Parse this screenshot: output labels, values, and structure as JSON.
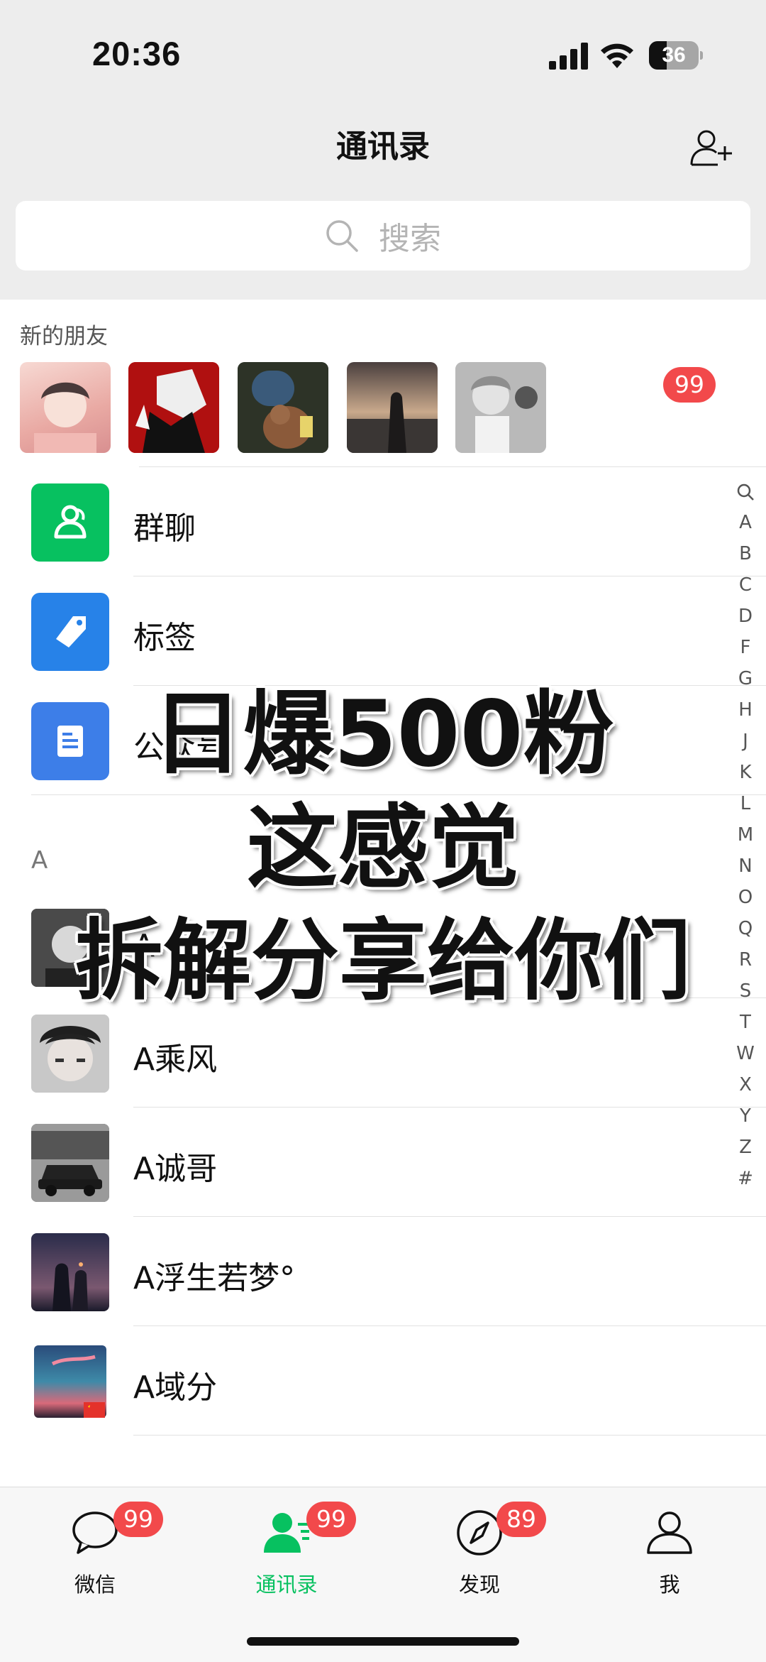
{
  "status_bar": {
    "time": "20:36",
    "battery": "36",
    "battery_level": 0.36
  },
  "header": {
    "title": "通讯录"
  },
  "search": {
    "placeholder": "搜索"
  },
  "new_friends": {
    "label": "新的朋友",
    "badge": "99"
  },
  "functions": [
    {
      "label": "群聊",
      "color": "#07c160"
    },
    {
      "label": "标签",
      "color": "#2782e8"
    },
    {
      "label": "公众号",
      "color": "#3d7ee8"
    }
  ],
  "section": {
    "letter": "A"
  },
  "contacts": [
    {
      "name": "A"
    },
    {
      "name": "A乘风"
    },
    {
      "name": "A诚哥"
    },
    {
      "name": "A浮生若梦°"
    },
    {
      "name": "A域分"
    }
  ],
  "index_letters": [
    "A",
    "B",
    "C",
    "D",
    "F",
    "G",
    "H",
    "J",
    "K",
    "L",
    "M",
    "N",
    "O",
    "Q",
    "R",
    "S",
    "T",
    "W",
    "X",
    "Y",
    "Z",
    "#"
  ],
  "overlay": {
    "line1": "日爆500粉",
    "line2": "这感觉",
    "line3": "拆解分享给你们"
  },
  "tabs": [
    {
      "label": "微信",
      "badge": "99",
      "active": false
    },
    {
      "label": "通讯录",
      "badge": "99",
      "active": true
    },
    {
      "label": "发现",
      "badge": "89",
      "active": false
    },
    {
      "label": "我",
      "badge": "",
      "active": false
    }
  ],
  "colors": {
    "accent": "#07c160",
    "badge": "#f2494b",
    "background": "#ededed"
  }
}
